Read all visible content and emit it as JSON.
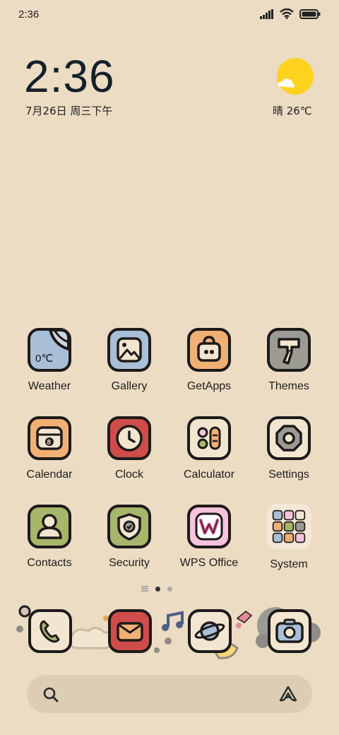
{
  "status_bar": {
    "time": "2:36"
  },
  "widget": {
    "clock": "2:36",
    "date": "7月26日 周三下午",
    "weather": "晴 26℃"
  },
  "apps": [
    {
      "label": "Weather",
      "icon": "weather-icon",
      "tile_text": "0℃"
    },
    {
      "label": "Gallery",
      "icon": "gallery-icon"
    },
    {
      "label": "GetApps",
      "icon": "getapps-icon"
    },
    {
      "label": "Themes",
      "icon": "themes-icon"
    },
    {
      "label": "Calendar",
      "icon": "calendar-icon",
      "tile_text": "8"
    },
    {
      "label": "Clock",
      "icon": "clock-icon"
    },
    {
      "label": "Calculator",
      "icon": "calculator-icon"
    },
    {
      "label": "Settings",
      "icon": "settings-icon"
    },
    {
      "label": "Contacts",
      "icon": "contacts-icon"
    },
    {
      "label": "Security",
      "icon": "security-icon"
    },
    {
      "label": "WPS Office",
      "icon": "wps-office-icon"
    },
    {
      "label": "System",
      "icon": "folder-icon"
    }
  ],
  "dock": [
    {
      "icon": "phone-icon"
    },
    {
      "icon": "messages-icon"
    },
    {
      "icon": "browser-icon"
    },
    {
      "icon": "camera-icon"
    }
  ],
  "colors": {
    "background": "#ecdcc3",
    "outline": "#1d1a1a",
    "blue": "#a9bfd8",
    "orange": "#f0b073",
    "gray": "#9c9b93",
    "red": "#d04c4a",
    "cream": "#f3e6d0",
    "green": "#a7b66a",
    "pink": "#f7c2dc",
    "sun": "#ffd21f"
  }
}
